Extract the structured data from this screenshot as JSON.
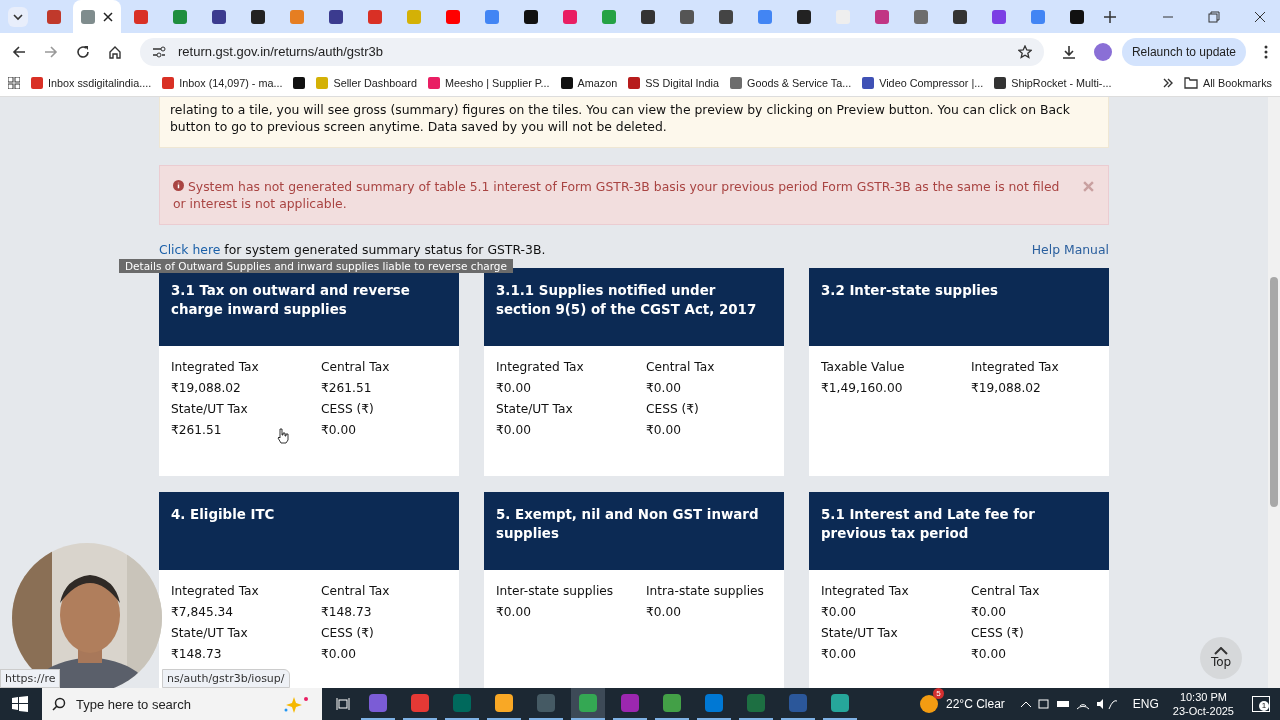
{
  "browser": {
    "tabs": [
      {
        "color": "#c0392b",
        "selected": false
      },
      {
        "color": "#7f8c8d",
        "selected": true
      },
      {
        "color": "#d93025",
        "selected": false
      },
      {
        "color": "#1e8e3e",
        "selected": false
      },
      {
        "color": "#3b3b8f",
        "selected": false
      },
      {
        "color": "#222222",
        "selected": false
      },
      {
        "color": "#e67e22",
        "selected": false
      },
      {
        "color": "#3b3b8f",
        "selected": false
      },
      {
        "color": "#d93025",
        "selected": false
      },
      {
        "color": "#d4b106",
        "selected": false
      },
      {
        "color": "#ff0000",
        "selected": false
      },
      {
        "color": "#4285f4",
        "selected": false
      },
      {
        "color": "#111111",
        "selected": false
      },
      {
        "color": "#e91e63",
        "selected": false
      },
      {
        "color": "#25a244",
        "selected": false
      },
      {
        "color": "#333333",
        "selected": false
      },
      {
        "color": "#555555",
        "selected": false
      },
      {
        "color": "#444444",
        "selected": false
      },
      {
        "color": "#4285f4",
        "selected": false
      },
      {
        "color": "#222222",
        "selected": false
      },
      {
        "color": "#eeeeee",
        "selected": false
      },
      {
        "color": "#c13584",
        "selected": false
      },
      {
        "color": "#6d6d6d",
        "selected": false
      },
      {
        "color": "#333333",
        "selected": false
      },
      {
        "color": "#7b3fe4",
        "selected": false
      },
      {
        "color": "#4285f4",
        "selected": false
      },
      {
        "color": "#111111",
        "selected": false
      }
    ],
    "url": "return.gst.gov.in/returns/auth/gstr3b",
    "relaunch": "Relaunch to update",
    "bookmarks": [
      {
        "label": "Inbox ssdigitalindia....",
        "color": "#d93025"
      },
      {
        "label": "Inbox (14,097) - ma...",
        "color": "#d93025"
      },
      {
        "color": "#111111"
      },
      {
        "label": "Seller Dashboard",
        "color": "#d4b106"
      },
      {
        "label": "Meesho | Supplier P...",
        "color": "#e91e63"
      },
      {
        "label": "Amazon",
        "color": "#111111"
      },
      {
        "label": "SS Digital India",
        "color": "#b71c1c"
      },
      {
        "label": "Goods & Service Ta...",
        "color": "#6d6d6d"
      },
      {
        "label": "Video Compressor |...",
        "color": "#3f51b5"
      },
      {
        "label": "ShipRocket - Multi-...",
        "color": "#333333"
      }
    ],
    "all_bookmarks": "All Bookmarks",
    "status_url": [
      "https://re",
      "ns/auth/gstr3b/iosup/"
    ]
  },
  "page": {
    "info": "relating to a tile, you will see gross (summary) figures on the tiles. You can view the preview by clicking on Preview button. You can click on Back button to go to previous screen anytime. Data saved by you will not be deleted.",
    "alert": "System has not generated summary of table 5.1 interest of Form GSTR-3B basis your previous period Form GSTR-3B as the same is not filed or interest is not applicable.",
    "link": "Click here",
    "link_rest": "for system generated summary status for GSTR-3B.",
    "help": "Help Manual",
    "tooltip": "Details of Outward Supplies and inward supplies liable to reverse charge",
    "tiles": [
      {
        "title": "3.1 Tax on outward and reverse charge inward supplies",
        "fields": [
          {
            "label": "Integrated Tax",
            "value": "₹19,088.02"
          },
          {
            "label": "Central Tax",
            "value": "₹261.51"
          },
          {
            "label": "State/UT Tax",
            "value": "₹261.51"
          },
          {
            "label": "CESS (₹)",
            "value": "₹0.00"
          }
        ]
      },
      {
        "title": "3.1.1 Supplies notified under section 9(5) of the CGST Act, 2017",
        "fields": [
          {
            "label": "Integrated Tax",
            "value": "₹0.00"
          },
          {
            "label": "Central Tax",
            "value": "₹0.00"
          },
          {
            "label": "State/UT Tax",
            "value": "₹0.00"
          },
          {
            "label": "CESS (₹)",
            "value": "₹0.00"
          }
        ]
      },
      {
        "title": "3.2 Inter-state supplies",
        "fields": [
          {
            "label": "Taxable Value",
            "value": "₹1,49,160.00"
          },
          {
            "label": "Integrated Tax",
            "value": "₹19,088.02"
          }
        ]
      },
      {
        "title": "4. Eligible ITC",
        "fields": [
          {
            "label": "Integrated Tax",
            "value": "₹7,845.34"
          },
          {
            "label": "Central Tax",
            "value": "₹148.73"
          },
          {
            "label": "State/UT Tax",
            "value": "₹148.73"
          },
          {
            "label": "CESS (₹)",
            "value": "₹0.00"
          }
        ]
      },
      {
        "title": "5. Exempt, nil and Non GST inward supplies",
        "fields": [
          {
            "label": "Inter-state supplies",
            "value": "₹0.00"
          },
          {
            "label": "Intra-state supplies",
            "value": "₹0.00"
          }
        ]
      },
      {
        "title": "5.1 Interest and Late fee for previous tax period",
        "fields": [
          {
            "label": "Integrated Tax",
            "value": "₹0.00"
          },
          {
            "label": "Central Tax",
            "value": "₹0.00"
          },
          {
            "label": "State/UT Tax",
            "value": "₹0.00"
          },
          {
            "label": "CESS (₹)",
            "value": "₹0.00"
          }
        ]
      }
    ],
    "top": "Top"
  },
  "taskbar": {
    "search": "Type here to search",
    "apps": [
      {
        "color": "#7b5cd6",
        "selected": false
      },
      {
        "color": "#e53935",
        "selected": false
      },
      {
        "color": "#00695c",
        "selected": false
      },
      {
        "color": "#f9a825",
        "selected": false
      },
      {
        "color": "#455a64",
        "selected": false
      },
      {
        "color": "#34a853",
        "selected": true
      },
      {
        "color": "#9c27b0",
        "selected": false
      },
      {
        "color": "#43a047",
        "selected": false
      },
      {
        "color": "#0078d4",
        "selected": false
      },
      {
        "color": "#1d6f42",
        "selected": false
      },
      {
        "color": "#2b579a",
        "selected": false
      },
      {
        "color": "#26a69a",
        "selected": false
      }
    ],
    "weather_badge": "5",
    "weather": "22°C Clear",
    "lang": "ENG",
    "time": "10:30 PM",
    "date": "23-Oct-2025",
    "notif": "1"
  }
}
